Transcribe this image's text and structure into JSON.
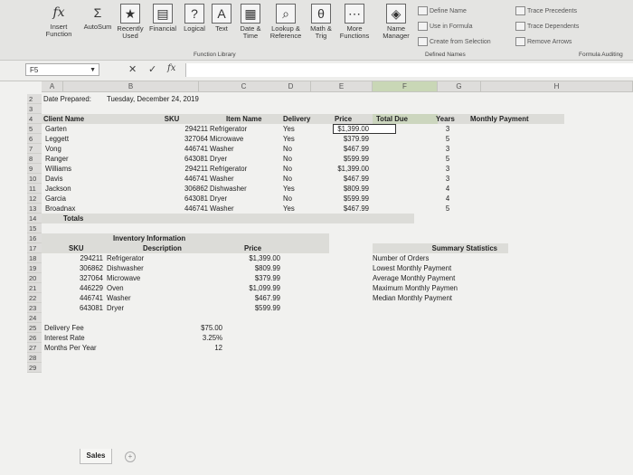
{
  "ribbon": {
    "insert_function": "Insert\nFunction",
    "autosum": "AutoSum",
    "recently_used": "Recently\nUsed",
    "financial": "Financial",
    "logical": "Logical",
    "text": "Text",
    "date_time": "Date &\nTime",
    "lookup": "Lookup &\nReference",
    "math": "Math &\nTrig",
    "more": "More\nFunctions",
    "function_library": "Function Library",
    "name_manager": "Name\nManager",
    "define_name": "Define Name",
    "use_in_formula": "Use in Formula",
    "create_from_selection": "Create from Selection",
    "defined_names": "Defined Names",
    "trace_precedents": "Trace Precedents",
    "trace_dependents": "Trace Dependents",
    "remove_arrows": "Remove Arrows",
    "formula_auditing": "Formula Auditing"
  },
  "formula_bar": {
    "name_box": "F5",
    "cancel": "✕",
    "enter": "✓",
    "fx": "fx"
  },
  "columns": [
    "A",
    "B",
    "C",
    "D",
    "E",
    "F",
    "G",
    "H"
  ],
  "rows": [
    "2",
    "3",
    "4",
    "5",
    "6",
    "7",
    "8",
    "9",
    "10",
    "11",
    "12",
    "13",
    "14",
    "15",
    "16",
    "17",
    "18",
    "19",
    "20",
    "21",
    "22",
    "23",
    "24",
    "25",
    "26",
    "27",
    "28",
    "29"
  ],
  "sheet": {
    "date_label": "Date Prepared:",
    "date_value": "Tuesday, December 24, 2019",
    "headers": {
      "client": "Client Name",
      "sku": "SKU",
      "item": "Item Name",
      "delivery": "Delivery",
      "price": "Price",
      "total_due": "Total Due",
      "years": "Years",
      "monthly": "Monthly Payment"
    },
    "orders": [
      {
        "client": "Garten",
        "sku": "294211",
        "item": "Refrigerator",
        "delivery": "Yes",
        "price": "$1,399.00",
        "years": "3"
      },
      {
        "client": "Leggett",
        "sku": "327064",
        "item": "Microwave",
        "delivery": "Yes",
        "price": "$379.99",
        "years": "5"
      },
      {
        "client": "Vong",
        "sku": "446741",
        "item": "Washer",
        "delivery": "No",
        "price": "$467.99",
        "years": "3"
      },
      {
        "client": "Ranger",
        "sku": "643081",
        "item": "Dryer",
        "delivery": "No",
        "price": "$599.99",
        "years": "5"
      },
      {
        "client": "Williams",
        "sku": "294211",
        "item": "Refrigerator",
        "delivery": "No",
        "price": "$1,399.00",
        "years": "3"
      },
      {
        "client": "Davis",
        "sku": "446741",
        "item": "Washer",
        "delivery": "No",
        "price": "$467.99",
        "years": "3"
      },
      {
        "client": "Jackson",
        "sku": "306862",
        "item": "Dishwasher",
        "delivery": "Yes",
        "price": "$809.99",
        "years": "4"
      },
      {
        "client": "Garcia",
        "sku": "643081",
        "item": "Dryer",
        "delivery": "No",
        "price": "$599.99",
        "years": "4"
      },
      {
        "client": "Broadnax",
        "sku": "446741",
        "item": "Washer",
        "delivery": "Yes",
        "price": "$467.99",
        "years": "5"
      }
    ],
    "totals": "Totals",
    "inventory_title": "Inventory Information",
    "inventory_headers": {
      "sku": "SKU",
      "description": "Description",
      "price": "Price"
    },
    "inventory": [
      {
        "sku": "294211",
        "description": "Refrigerator",
        "price": "$1,399.00"
      },
      {
        "sku": "306862",
        "description": "Dishwasher",
        "price": "$809.99"
      },
      {
        "sku": "327064",
        "description": "Microwave",
        "price": "$379.99"
      },
      {
        "sku": "446229",
        "description": "Oven",
        "price": "$1,099.99"
      },
      {
        "sku": "446741",
        "description": "Washer",
        "price": "$467.99"
      },
      {
        "sku": "643081",
        "description": "Dryer",
        "price": "$599.99"
      }
    ],
    "summary_title": "Summary Statistics",
    "summary": [
      "Number of Orders",
      "Lowest Monthly Payment",
      "Average Monthly Payment",
      "Maximum Monthly Paymen",
      "Median Monthly Payment"
    ],
    "fees": [
      {
        "label": "Delivery Fee",
        "value": "$75.00"
      },
      {
        "label": "Interest Rate",
        "value": "3.25%"
      },
      {
        "label": "Months Per Year",
        "value": "12"
      }
    ]
  },
  "tabs": {
    "sales": "Sales",
    "add": "+"
  }
}
